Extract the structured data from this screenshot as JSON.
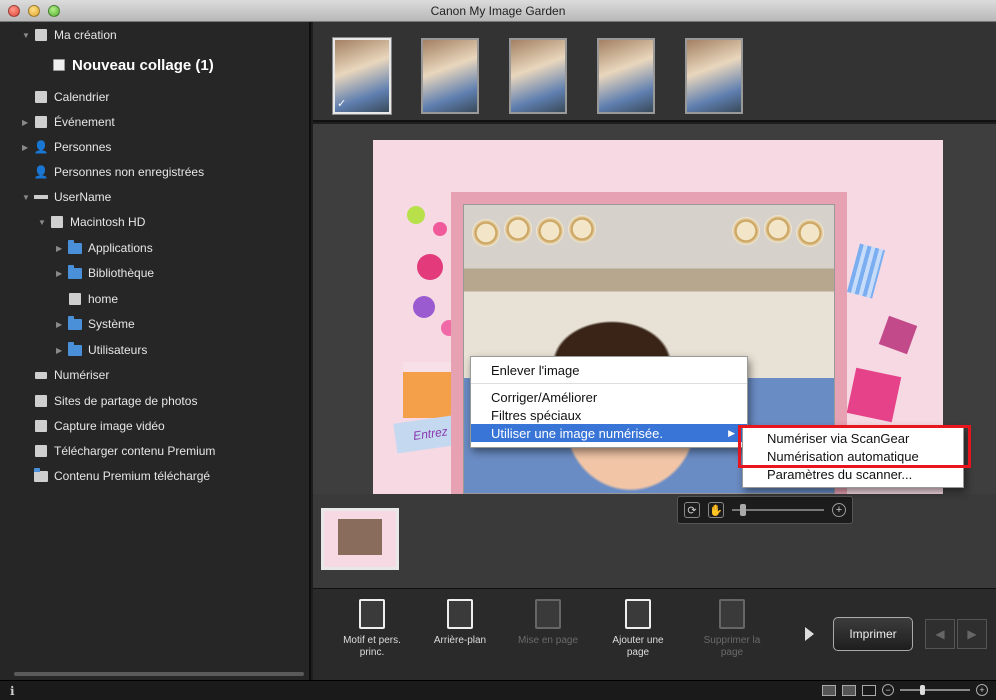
{
  "window": {
    "title": "Canon My Image Garden"
  },
  "sidebar": {
    "items": [
      {
        "label": "Ma création",
        "icon": "create-icon"
      },
      {
        "label": "Nouveau collage (1)",
        "icon": "collage-icon"
      },
      {
        "label": "Calendrier",
        "icon": "calendar-icon"
      },
      {
        "label": "Événement",
        "icon": "event-icon"
      },
      {
        "label": "Personnes",
        "icon": "person-icon"
      },
      {
        "label": "Personnes non enregistrées",
        "icon": "person-unregistered-icon"
      },
      {
        "label": "UserName",
        "icon": "user-icon"
      },
      {
        "label": "Macintosh HD",
        "icon": "disk-icon"
      },
      {
        "label": "Applications",
        "icon": "folder-icon"
      },
      {
        "label": "Bibliothèque",
        "icon": "folder-icon"
      },
      {
        "label": "home",
        "icon": "home-icon"
      },
      {
        "label": "Système",
        "icon": "folder-icon"
      },
      {
        "label": "Utilisateurs",
        "icon": "folder-icon"
      },
      {
        "label": "Numériser",
        "icon": "scanner-icon"
      },
      {
        "label": "Sites de partage de photos",
        "icon": "share-icon"
      },
      {
        "label": "Capture image vidéo",
        "icon": "video-capture-icon"
      },
      {
        "label": "Télécharger contenu Premium",
        "icon": "download-icon"
      },
      {
        "label": "Contenu Premium téléchargé",
        "icon": "folder-icon"
      }
    ]
  },
  "canvas": {
    "text_box": "Entrez d"
  },
  "context_menu": {
    "items": [
      "Enlever l'image",
      "Corriger/Améliorer",
      "Filtres spéciaux",
      "Utiliser une image numérisée."
    ]
  },
  "submenu": {
    "items": [
      "Numériser via ScanGear",
      "Numérisation automatique",
      "Paramètres du scanner..."
    ]
  },
  "toolbar": {
    "motif": "Motif et pers. princ.",
    "background": "Arrière-plan",
    "layout": "Mise en page",
    "add_page": "Ajouter une page",
    "delete_page": "Supprimer la page",
    "print": "Imprimer"
  },
  "colors": {
    "page_background": "#f6d9e2",
    "menu_highlight": "#3875d7",
    "callout": "#e8141e"
  }
}
